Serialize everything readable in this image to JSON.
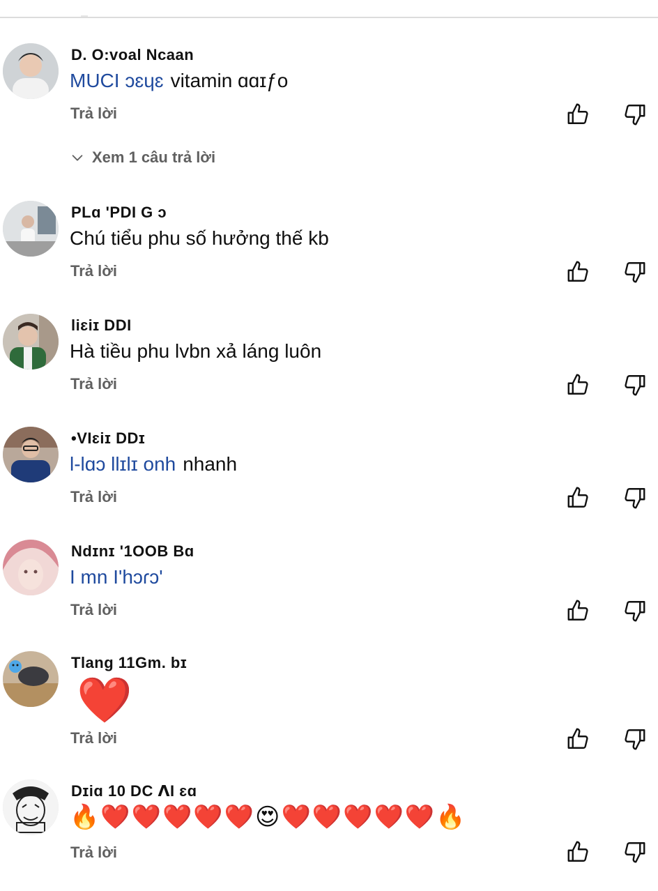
{
  "replies_toggle": {
    "label": "Xem 1 câu trả lời"
  },
  "comments": [
    {
      "author": "D.  O:voal  Ncaan",
      "mention": "MUCI ɔɛɥɛ",
      "text": "vitamin ɑɑɪƒo",
      "reply_label": "Trả lời"
    },
    {
      "author": "PLɑ  'PDI  G ɔ",
      "mention": "",
      "text": "Chú tiểu phu số hưởng thế kb",
      "reply_label": "Trả lời"
    },
    {
      "author": "liɛiɪ    DDI",
      "mention": "",
      "text": "Hà tiều phu lvbn xả láng luôn",
      "reply_label": "Trả lời"
    },
    {
      "author": "•VIɛiɪ   DDɪ",
      "mention": "l-lɑɔ llɪlɪ onh",
      "text": "nhanh",
      "reply_label": "Trả lời"
    },
    {
      "author": "Ndɪnɪ  '1OOB   Bɑ",
      "mention": "I mn I'hɔɾɔ'",
      "text": "",
      "reply_label": "Trả lời"
    },
    {
      "author": "Tlang 11Gm.    bɪ",
      "mention": "",
      "text": "❤️",
      "reply_label": "Trả lời"
    },
    {
      "author": "Dɪiɑ  10 DC  ⴷI ɛɑ",
      "mention": "",
      "text": "🔥❤️❤️❤️❤️❤️😍❤️❤️❤️❤️❤️🔥",
      "reply_label": "Trả lời"
    }
  ],
  "icons": {
    "like": "thumbs-up-icon",
    "dislike": "thumbs-down-icon",
    "chevron": "chevron-down-icon"
  }
}
